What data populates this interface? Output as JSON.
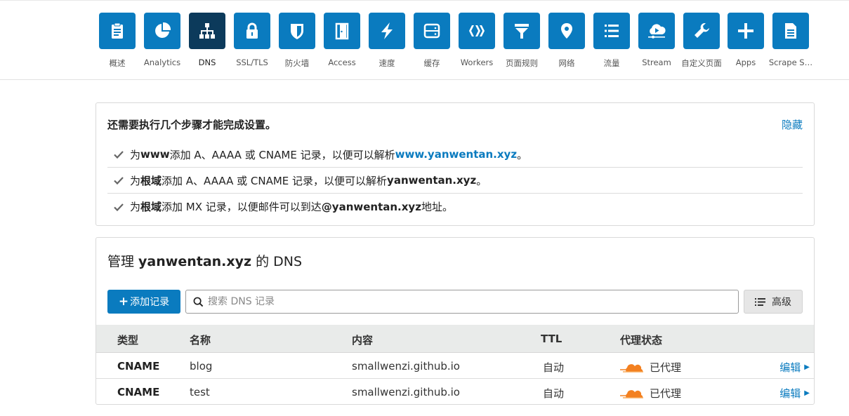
{
  "nav": {
    "items": [
      {
        "label": "概述",
        "icon": "clipboard-icon",
        "active": false
      },
      {
        "label": "Analytics",
        "icon": "pie-chart-icon",
        "active": false
      },
      {
        "label": "DNS",
        "icon": "network-icon",
        "active": true
      },
      {
        "label": "SSL/TLS",
        "icon": "lock-icon",
        "active": false
      },
      {
        "label": "防火墙",
        "icon": "shield-icon",
        "active": false
      },
      {
        "label": "Access",
        "icon": "door-icon",
        "active": false
      },
      {
        "label": "速度",
        "icon": "lightning-icon",
        "active": false
      },
      {
        "label": "缓存",
        "icon": "server-icon",
        "active": false
      },
      {
        "label": "Workers",
        "icon": "workers-icon",
        "active": false
      },
      {
        "label": "页面规则",
        "icon": "filter-icon",
        "active": false
      },
      {
        "label": "网络",
        "icon": "location-pin-icon",
        "active": false
      },
      {
        "label": "流量",
        "icon": "list-icon",
        "active": false
      },
      {
        "label": "Stream",
        "icon": "cloud-play-icon",
        "active": false
      },
      {
        "label": "自定义页面",
        "icon": "wrench-icon",
        "active": false
      },
      {
        "label": "Apps",
        "icon": "plus-icon",
        "active": false
      },
      {
        "label": "Scrape S…",
        "icon": "document-icon",
        "active": false
      }
    ]
  },
  "setup": {
    "title": "还需要执行几个步骤才能完成设置。",
    "hide_label": "隐藏",
    "steps": [
      {
        "pre": "为 ",
        "bold": "www",
        "mid": " 添加 A、AAAA 或 CNAME 记录，以便可以解析 ",
        "target": "www.yanwentan.xyz",
        "post": "。"
      },
      {
        "pre": "为 ",
        "bold": "根域",
        "mid": " 添加 A、AAAA 或 CNAME 记录，以便可以解析 ",
        "target": "yanwentan.xyz",
        "post": "。"
      },
      {
        "pre": "为 ",
        "bold": "根域",
        "mid": " 添加 MX 记录，以便邮件可以到达 ",
        "target": "@yanwentan.xyz",
        "post": " 地址。"
      }
    ]
  },
  "dns": {
    "title_pre": "管理 ",
    "title_domain": "yanwentan.xyz",
    "title_post": " 的 DNS",
    "add_label": "添加记录",
    "search_placeholder": "搜索 DNS 记录",
    "advanced_label": "高级",
    "columns": {
      "type": "类型",
      "name": "名称",
      "content": "内容",
      "ttl": "TTL",
      "proxy": "代理状态"
    },
    "records": [
      {
        "type": "CNAME",
        "name": "blog",
        "content": "smallwenzi.github.io",
        "ttl": "自动",
        "proxy": "已代理",
        "edit": "编辑"
      },
      {
        "type": "CNAME",
        "name": "test",
        "content": "smallwenzi.github.io",
        "ttl": "自动",
        "proxy": "已代理",
        "edit": "编辑"
      }
    ]
  },
  "colors": {
    "accent": "#0a7bbf",
    "active_tile": "#0c3a5b",
    "proxy_orange": "#f38020"
  }
}
